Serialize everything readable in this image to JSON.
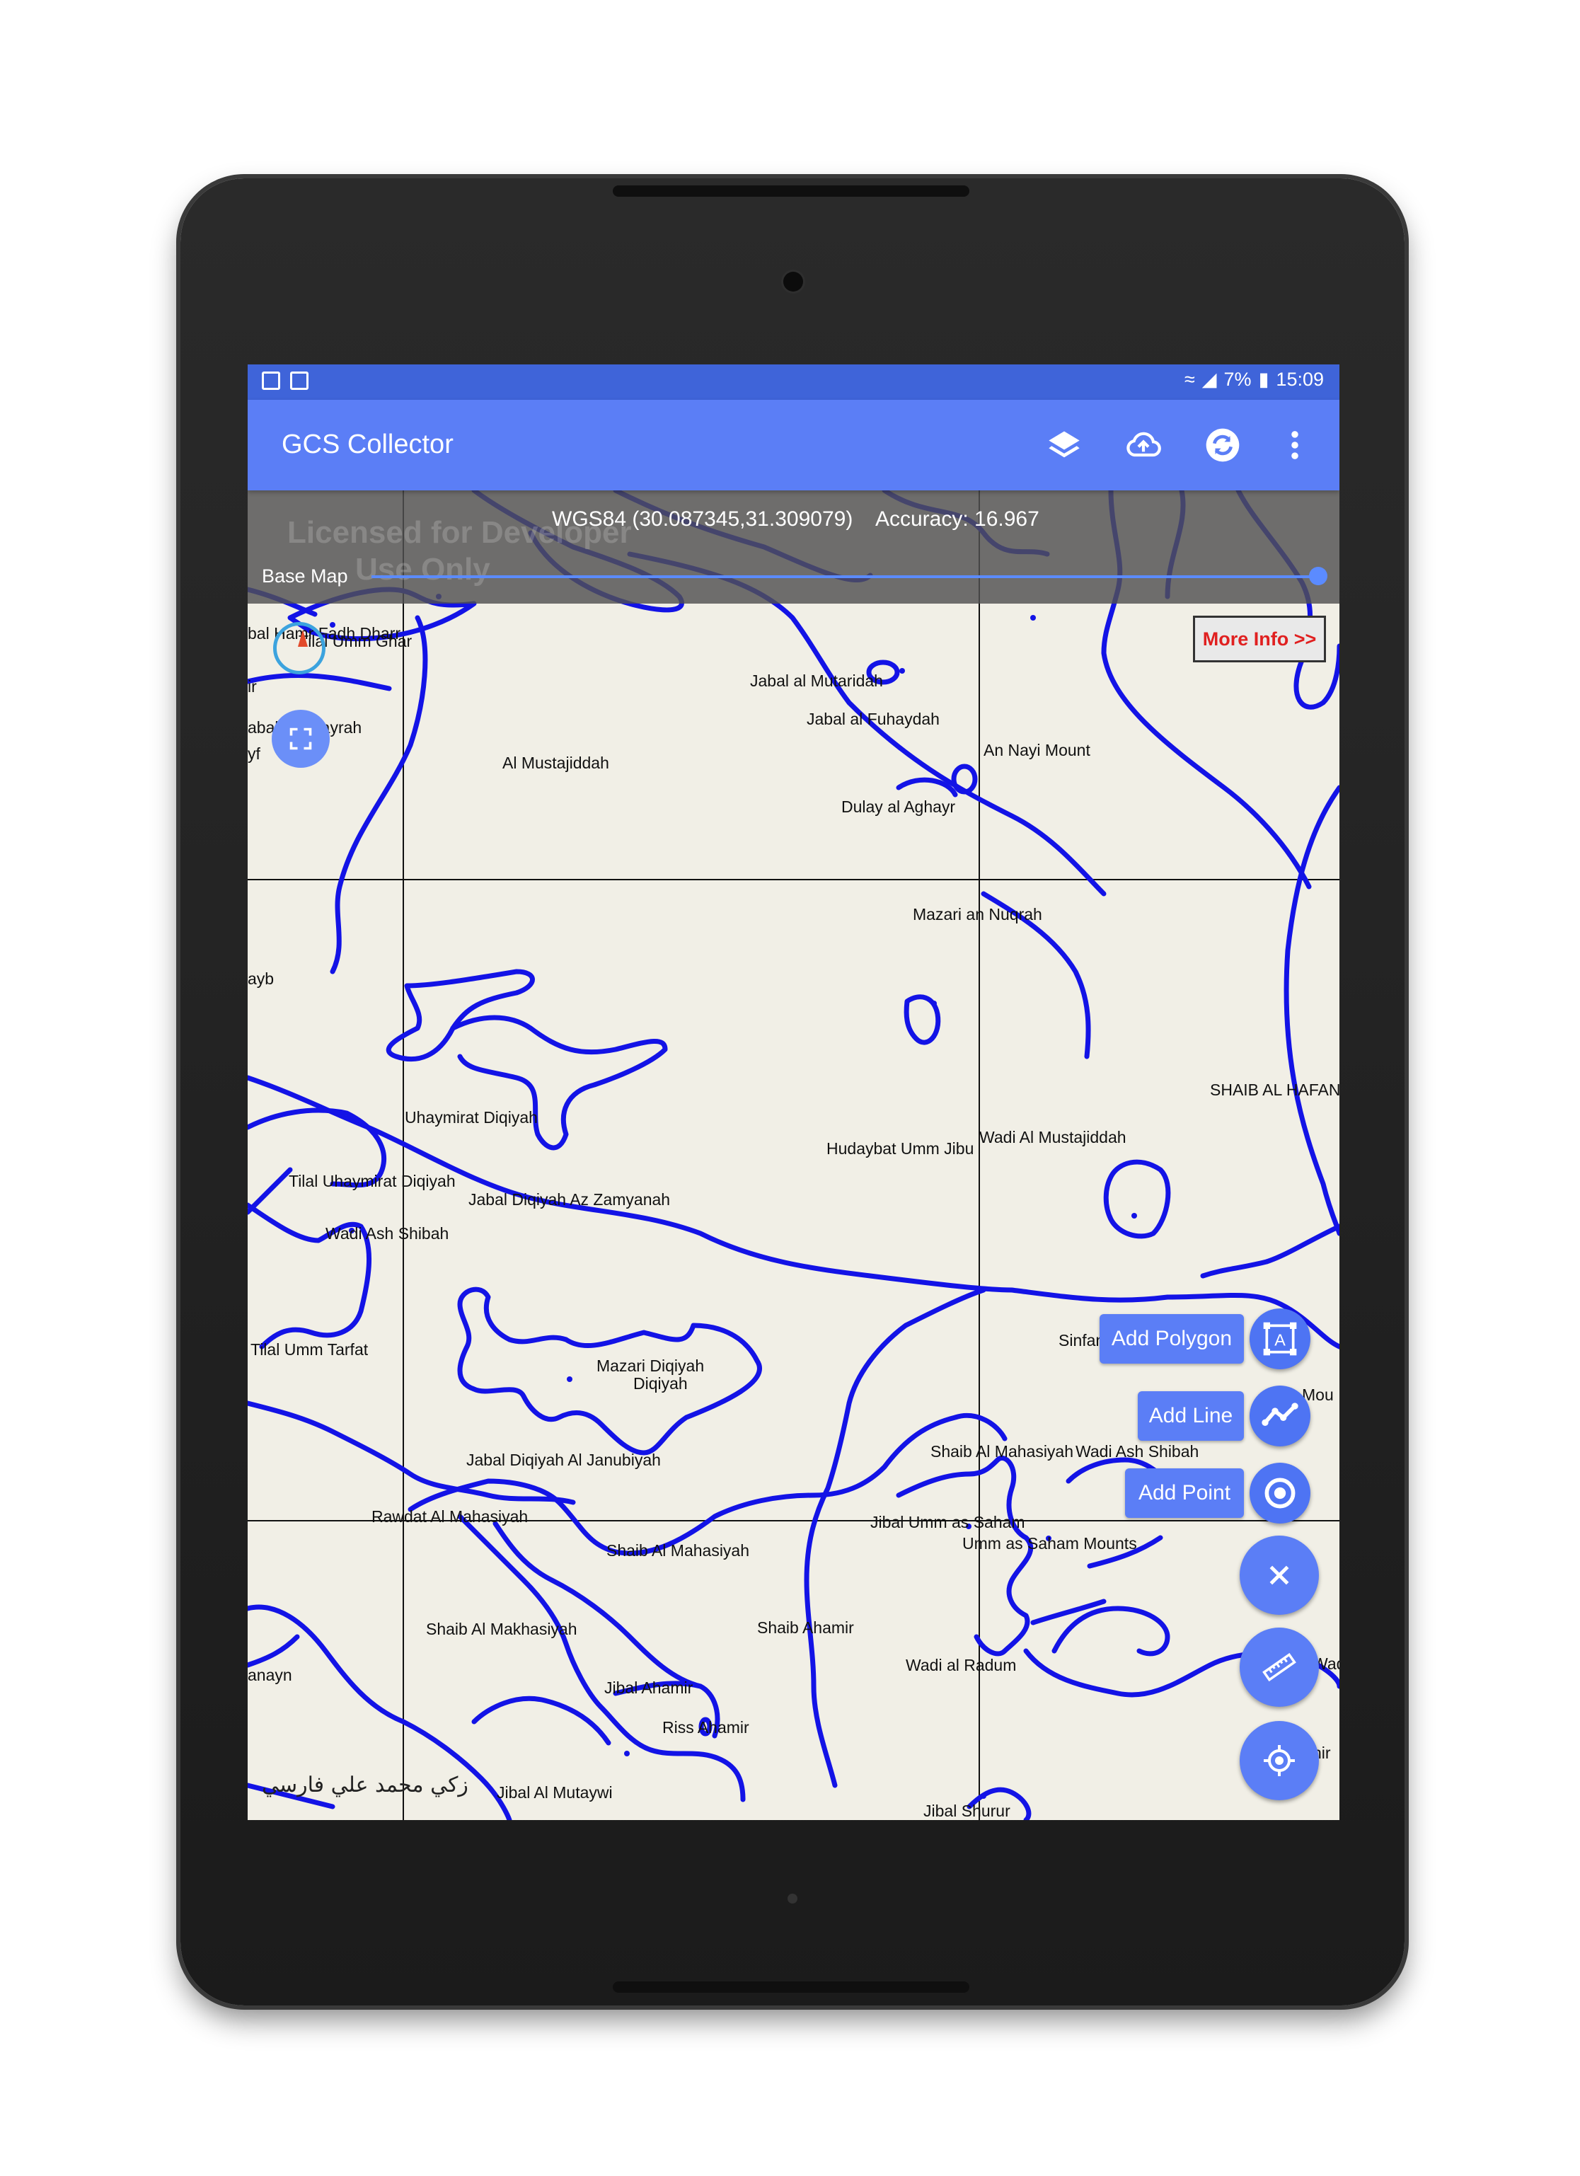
{
  "status_bar": {
    "battery": "7%",
    "time": "15:09"
  },
  "app_bar": {
    "title": "GCS Collector",
    "actions": [
      "layers-icon",
      "cloud-upload-icon",
      "sync-icon",
      "more-vert-icon"
    ]
  },
  "info_bar": {
    "coords": "WGS84 (30.087345,31.309079)    Accuracy: 16.967",
    "watermark_line1": "Licensed for Developer",
    "watermark_line2": "Use Only",
    "base_map_label": "Base Map",
    "base_map_opacity_fraction": 1.0
  },
  "more_info_label": "More Info >>",
  "actions": {
    "add_polygon": "Add Polygon",
    "add_line": "Add Line",
    "add_point": "Add Point"
  },
  "map_labels": [
    "Tilal Umm Ghar",
    "Jabal al Mutaridah",
    "Jabal al Fuhaydah",
    "An Nayi Mount",
    "Al Mustajiddah",
    "Dulay al Aghayr",
    "Mazari an Nuqrah",
    "ayb",
    "SHAIB AL HAFAN",
    "Uhaymirat Diqiyah",
    "Hudaybat Umm Jibu",
    "Wadi Al Mustajiddah",
    "Tilal Uhaymirat Diqiyah",
    "Jabal Diqiyah Az Zamyanah",
    "Wadi Ash Shibah",
    "Sinfan Al Qunaynah",
    "Tilal Umm Tarfat",
    "Mazari Diqiyah",
    "Diqiyah",
    "Jabal Diqiyah Al Janubiyah",
    "Shaib Al Mahasiyah",
    "Wadi Ash Shibah",
    "Rawdat Al Mahasiyah",
    "Jibal Umm as Saham",
    "Umm as Saham Mounts",
    "Shaib Al Mahasiyah",
    "Shaib Al Makhasiyah",
    "Shaib Ahamir",
    "Wadi al Radum",
    "anayn",
    "Jibal Ahamir",
    "Riss Ahamir",
    "Jibal Al Mutaywi",
    "Jibal Shurur",
    "Mou",
    "Wad",
    "hir",
    "bal Hamr Fadh Dharr",
    "abal",
    "rayrah",
    "yf",
    "ir"
  ],
  "signature_text": "زكي محمد علي فارسي"
}
